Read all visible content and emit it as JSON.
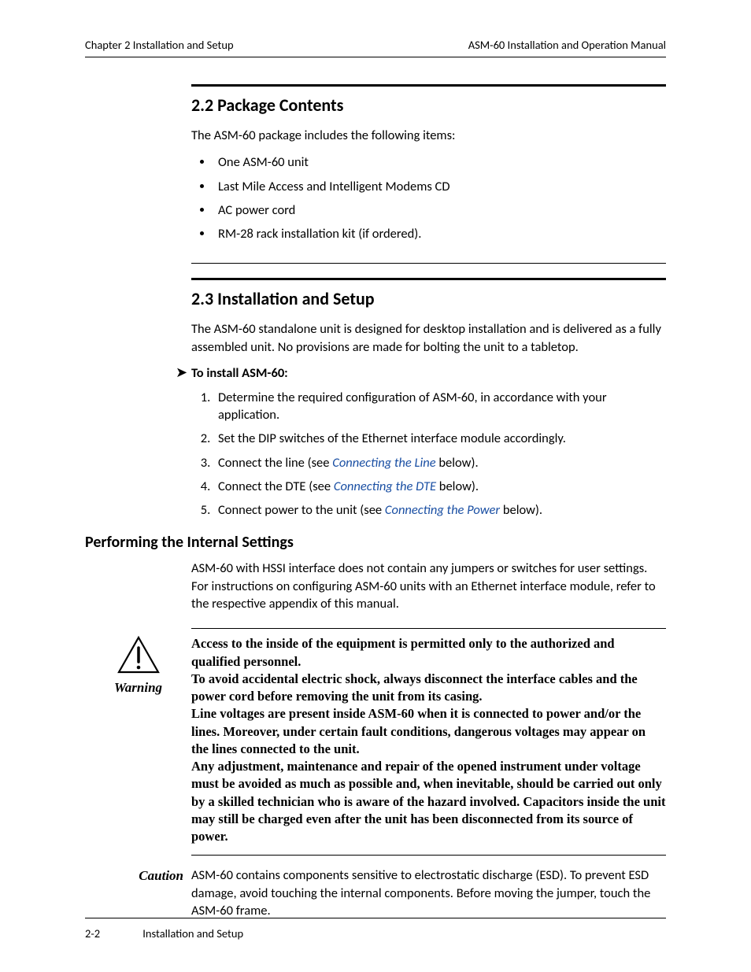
{
  "header": {
    "left": "Chapter 2  Installation and Setup",
    "right_bold": "ASM-60",
    "right_rest": " Installation and Operation Manual"
  },
  "section22": {
    "title": "2.2  Package Contents",
    "intro": "The ASM-60 package includes the following items:",
    "items": [
      "One ASM-60 unit",
      "Last Mile Access and Intelligent Modems CD",
      "AC power cord",
      "RM-28 rack installation kit (if ordered)."
    ]
  },
  "section23": {
    "title": "2.3  Installation and Setup",
    "intro": "The ASM-60 standalone unit is designed for desktop installation and is delivered as a fully assembled unit. No provisions are made for bolting the unit to a tabletop.",
    "proc_title": "To install ASM-60:",
    "steps": {
      "s1": "Determine the required configuration of ASM-60, in accordance with your application.",
      "s2": "Set the DIP switches of the Ethernet interface module accordingly.",
      "s3a": "Connect the line (see ",
      "s3link": "Connecting the Line",
      "s3b": " below).",
      "s4a": "Connect the DTE (see ",
      "s4link": "Connecting the DTE",
      "s4b": " below).",
      "s5a": "Connect power to the unit (see ",
      "s5link": "Connecting the Power",
      "s5b": " below)."
    }
  },
  "subsection": {
    "title": "Performing the Internal Settings",
    "para": "ASM-60 with HSSI interface does not contain any jumpers or switches for user settings. For instructions on configuring ASM-60 units with an Ethernet interface module, refer to the respective appendix of this manual."
  },
  "warning": {
    "label": "Warning",
    "text": "Access to the inside of the equipment is permitted only to the authorized and qualified personnel.\nTo avoid accidental electric shock, always disconnect the interface cables and the power cord before removing the unit from its casing.\nLine voltages are present inside ASM-60 when it is connected to power and/or the lines. Moreover, under certain fault conditions, dangerous voltages may appear on the lines connected to the unit.\nAny adjustment, maintenance and repair of the opened instrument under voltage must be avoided as much as possible and, when inevitable, should be carried out only by a skilled technician who is aware of the hazard involved. Capacitors inside the unit may still be charged even after the unit has been disconnected from its source of power."
  },
  "caution": {
    "label": "Caution",
    "text": "ASM-60 contains components sensitive to electrostatic discharge (ESD). To prevent ESD damage, avoid touching the internal components. Before moving the jumper, touch the ASM-60 frame."
  },
  "footer": {
    "page": "2-2",
    "title": "Installation and Setup"
  }
}
